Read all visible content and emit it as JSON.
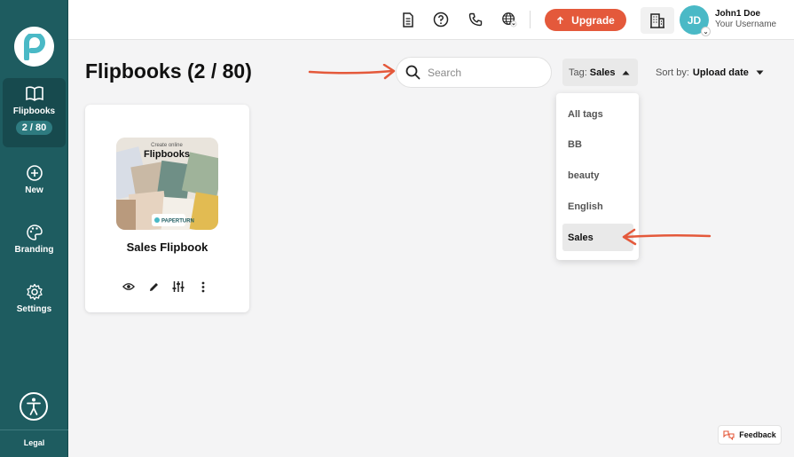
{
  "sidebar": {
    "items": [
      {
        "label": "Flipbooks",
        "badge": "2 / 80",
        "icon": "book-open-icon"
      },
      {
        "label": "New",
        "icon": "plus-circle-icon"
      },
      {
        "label": "Branding",
        "icon": "palette-icon"
      },
      {
        "label": "Settings",
        "icon": "gear-icon"
      }
    ],
    "legal": "Legal"
  },
  "topbar": {
    "upgrade_label": "Upgrade",
    "avatar_initials": "JD",
    "user_name": "John1 Doe",
    "user_sub": "Your Username"
  },
  "main": {
    "title": "Flipbooks (2 / 80)",
    "search_placeholder": "Search",
    "tag_label": "Tag:",
    "tag_value": "Sales",
    "sort_label": "Sort by:",
    "sort_value": "Upload date"
  },
  "tag_dropdown": {
    "options": [
      "All tags",
      "BB",
      "beauty",
      "English",
      "Sales"
    ],
    "selected": "Sales"
  },
  "cards": [
    {
      "title": "Sales Flipbook",
      "thumb_text_small": "Create online",
      "thumb_text_big": "Flipbooks",
      "thumb_brand": "PAPERTURN"
    }
  ],
  "feedback_label": "Feedback",
  "colors": {
    "sidebar": "#1e5c60",
    "accent": "#e4593b",
    "avatar": "#4ab9c6"
  }
}
